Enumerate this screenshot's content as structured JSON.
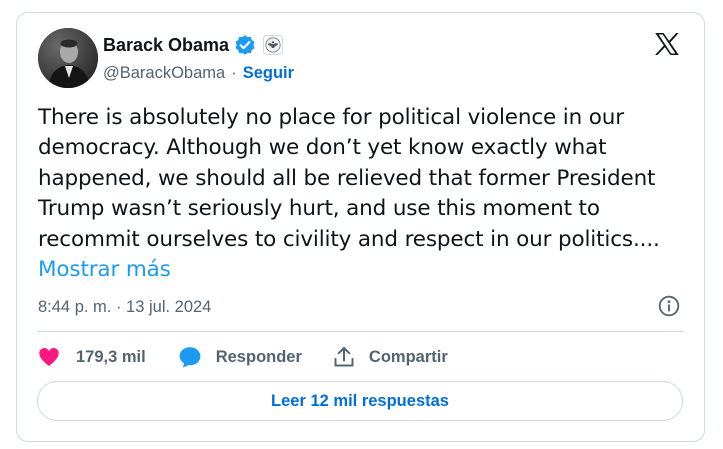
{
  "author": {
    "display_name": "Barack Obama",
    "handle": "@BarackObama",
    "separator": "·",
    "follow_label": "Seguir",
    "verified_badge_icon": "blue-checkmark-icon",
    "affiliation_icon": "presidential-seal-icon"
  },
  "platform_logo": "x-logo-icon",
  "tweet": {
    "text": "There is absolutely no place for political violence in our democracy. Although we don’t yet know exactly what happened, we should all be relieved that former President Trump wasn’t seriously hurt, and use this moment to recommit ourselves to civility and respect in our politics....",
    "show_more_label": "Mostrar más"
  },
  "meta": {
    "timestamp": "8:44 p. m. · 13 jul. 2024",
    "info_icon": "info-icon"
  },
  "actions": {
    "likes_count": "179,3 mil",
    "likes_icon": "heart-icon",
    "reply_label": "Responder",
    "reply_icon": "speech-bubble-icon",
    "share_label": "Compartir",
    "share_icon": "share-icon"
  },
  "replies_button_label": "Leer 12 mil respuestas",
  "colors": {
    "link_blue": "#006fd6",
    "show_more_blue": "#1d9bf0",
    "like_pink": "#f91880",
    "reply_blue": "#1d9bf0",
    "muted_text": "#536471",
    "border": "#cfd9de"
  }
}
